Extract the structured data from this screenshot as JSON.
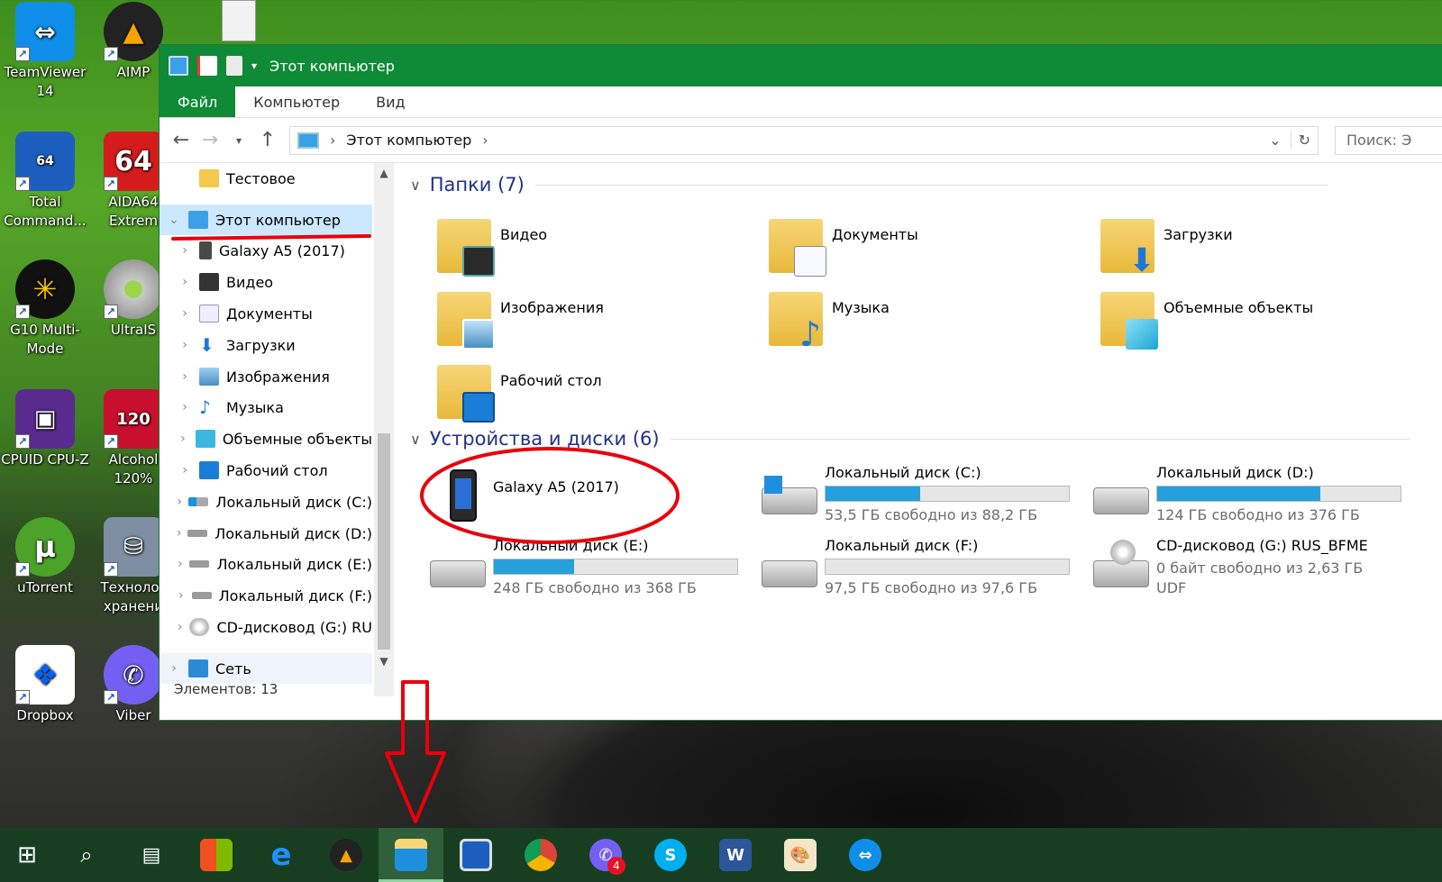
{
  "desktop": {
    "icons": [
      {
        "label": "TeamViewer 14",
        "icon": "teamviewer-icon"
      },
      {
        "label": "AIMP",
        "icon": "aimp-icon"
      },
      {
        "label": "Total Command...",
        "icon": "total-commander-icon"
      },
      {
        "label": "AIDA64 Extrem",
        "icon": "aida64-icon"
      },
      {
        "label": "G10 Multi-Mode",
        "icon": "g10-icon"
      },
      {
        "label": "UltraIS",
        "icon": "ultraiso-icon"
      },
      {
        "label": "CPUID CPU-Z",
        "icon": "cpuz-icon"
      },
      {
        "label": "Alcohol 120%",
        "icon": "alcohol-icon"
      },
      {
        "label": "uTorrent",
        "icon": "utorrent-icon"
      },
      {
        "label": "Технолог хранени",
        "icon": "storage-tech-icon"
      },
      {
        "label": "Dropbox",
        "icon": "dropbox-icon"
      },
      {
        "label": "Viber",
        "icon": "viber-icon"
      }
    ]
  },
  "window": {
    "title": "Этот компьютер",
    "ribbon_tabs": [
      "Файл",
      "Компьютер",
      "Вид"
    ],
    "address": {
      "location": "Этот компьютер",
      "search_placeholder": "Поиск: Э"
    },
    "nav": {
      "items": [
        {
          "label": "Тестовое",
          "icon": "folder-icon"
        },
        {
          "label": "Этот компьютер",
          "icon": "computer-icon",
          "selected": true
        },
        {
          "label": "Galaxy A5 (2017)",
          "icon": "phone-icon"
        },
        {
          "label": "Видео",
          "icon": "video-folder-icon"
        },
        {
          "label": "Документы",
          "icon": "documents-icon"
        },
        {
          "label": "Загрузки",
          "icon": "downloads-icon"
        },
        {
          "label": "Изображения",
          "icon": "pictures-icon"
        },
        {
          "label": "Музыка",
          "icon": "music-icon"
        },
        {
          "label": "Объемные объекты",
          "icon": "3d-objects-icon"
        },
        {
          "label": "Рабочий стол",
          "icon": "desktop-icon"
        },
        {
          "label": "Локальный диск (C:)",
          "icon": "drive-c-icon"
        },
        {
          "label": "Локальный диск (D:)",
          "icon": "drive-icon"
        },
        {
          "label": "Локальный диск (E:)",
          "icon": "drive-icon"
        },
        {
          "label": "Локальный диск (F:)",
          "icon": "drive-icon"
        },
        {
          "label": "CD-дисковод (G:) RU",
          "icon": "cd-drive-icon"
        },
        {
          "label": "Сеть",
          "icon": "network-icon"
        }
      ]
    },
    "status": "Элементов: 13",
    "groups": {
      "folders_title": "Папки (7)",
      "devices_title": "Устройства и диски (6)"
    },
    "folders": [
      {
        "label": "Видео",
        "icon": "video-folder-icon"
      },
      {
        "label": "Документы",
        "icon": "documents-icon"
      },
      {
        "label": "Загрузки",
        "icon": "downloads-icon"
      },
      {
        "label": "Изображения",
        "icon": "pictures-icon"
      },
      {
        "label": "Музыка",
        "icon": "music-icon"
      },
      {
        "label": "Объемные объекты",
        "icon": "3d-objects-icon"
      },
      {
        "label": "Рабочий стол",
        "icon": "desktop-icon"
      }
    ],
    "devices": [
      {
        "label": "Galaxy A5 (2017)",
        "icon": "phone-icon"
      },
      {
        "label": "Локальный диск (C:)",
        "free": "53,5 ГБ свободно из 88,2 ГБ",
        "used_fraction": 0.39
      },
      {
        "label": "Локальный диск (D:)",
        "free": "124 ГБ свободно из 376 ГБ",
        "used_fraction": 0.67
      },
      {
        "label": "Локальный диск (E:)",
        "free": "248 ГБ свободно из 368 ГБ",
        "used_fraction": 0.33
      },
      {
        "label": "Локальный диск (F:)",
        "free": "97,5 ГБ свободно из 97,6 ГБ",
        "used_fraction": 0.0
      },
      {
        "label": "CD-дисковод (G:) RUS_BFME",
        "free": "0 байт свободно из 2,63 ГБ",
        "fs": "UDF"
      }
    ]
  },
  "taskbar": {
    "items": [
      {
        "icon": "start-icon"
      },
      {
        "icon": "search-icon"
      },
      {
        "icon": "task-view-icon"
      },
      {
        "icon": "store-icon"
      },
      {
        "icon": "edge-icon"
      },
      {
        "icon": "aimp-icon"
      },
      {
        "icon": "file-explorer-icon",
        "active": true
      },
      {
        "icon": "total-commander-icon"
      },
      {
        "icon": "chrome-icon"
      },
      {
        "icon": "viber-icon",
        "badge": "4"
      },
      {
        "icon": "skype-icon"
      },
      {
        "icon": "word-icon"
      },
      {
        "icon": "paint-icon"
      },
      {
        "icon": "teamviewer-icon"
      }
    ]
  },
  "annotations": {
    "color": "#e8000c"
  }
}
